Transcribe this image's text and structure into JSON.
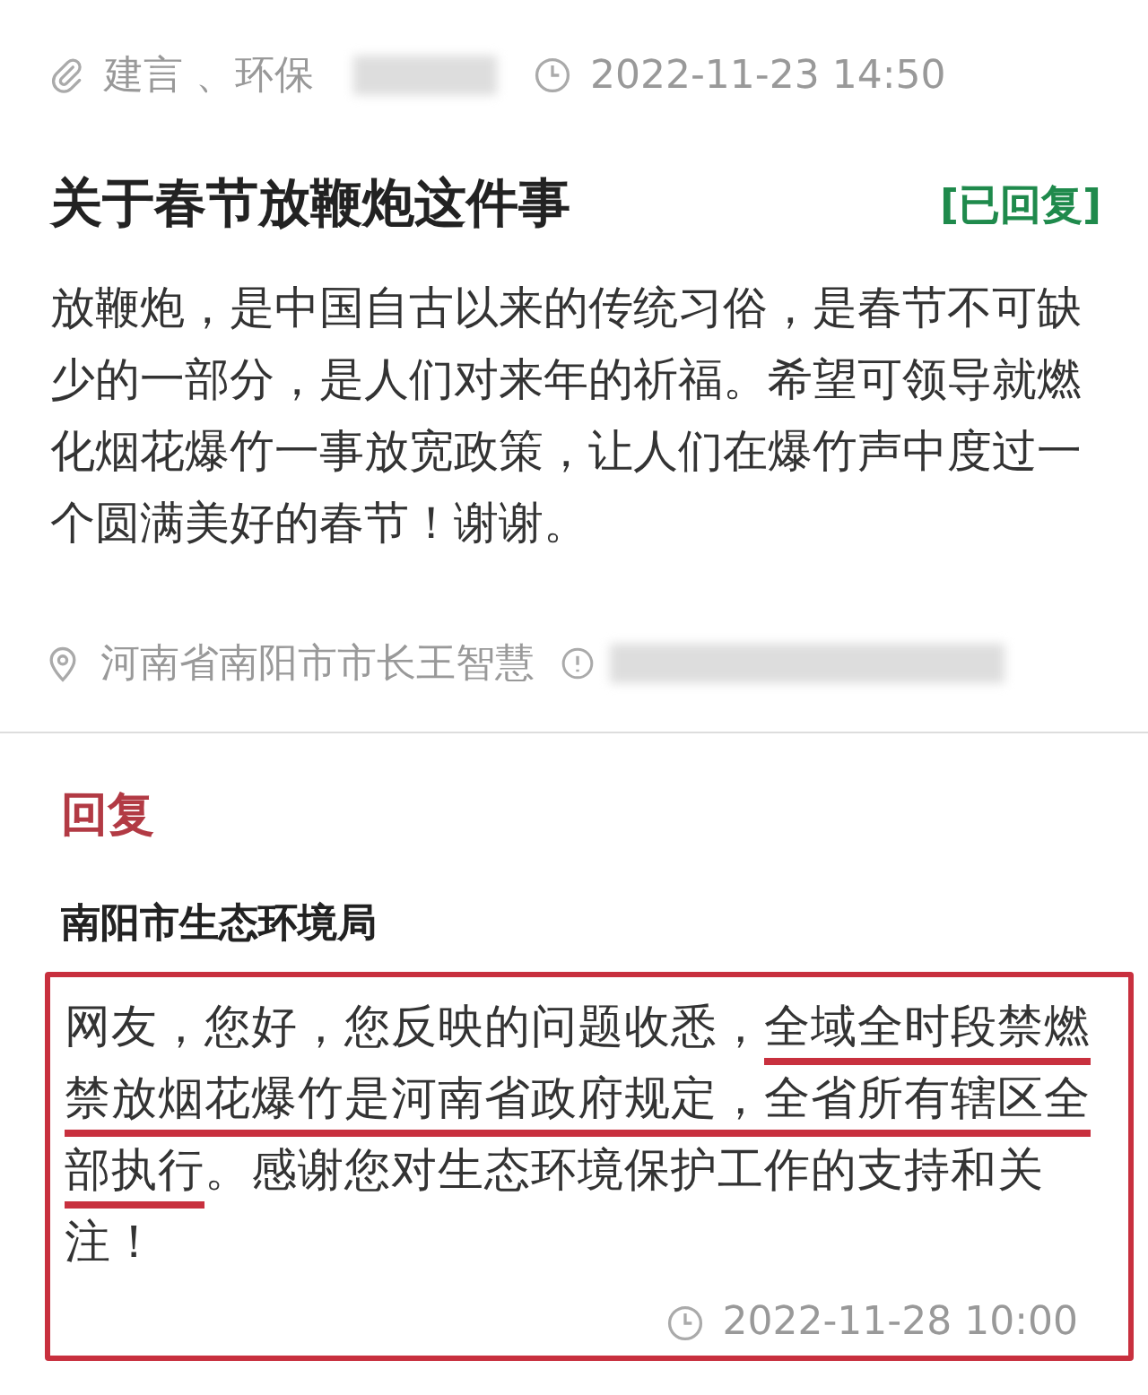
{
  "meta": {
    "tags": "建言 、环保",
    "time": "2022-11-23 14:50"
  },
  "title": "关于春节放鞭炮这件事",
  "status": {
    "label": "[已回复]",
    "kind": "replied"
  },
  "body": "放鞭炮，是中国自古以来的传统习俗，是春节不可缺少的一部分，是人们对来年的祈福。希望可领导就燃化烟花爆竹一事放宽政策，让人们在爆竹声中度过一个圆满美好的春节！谢谢。",
  "recipient": "河南省南阳市市长王智慧",
  "reply": {
    "heading": "回复",
    "department": "南阳市生态环境局",
    "segments": [
      {
        "text": "网友，您好，您反映的问题收悉，",
        "underlined": false
      },
      {
        "text": "全域全时段禁燃禁放烟花爆竹是河南省政府规定，全省所有辖区全部执行",
        "underlined": true
      },
      {
        "text": "。感谢您对生态环境保护工作的支持和关注！",
        "underlined": false
      }
    ],
    "time": "2022-11-28 10:00"
  }
}
